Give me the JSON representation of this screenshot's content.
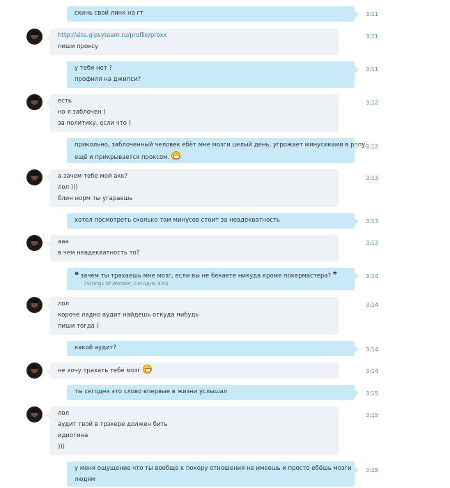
{
  "messages": [
    {
      "dir": "out",
      "time": "3:11",
      "lines": [
        "скинь свой линк на гт"
      ]
    },
    {
      "dir": "in",
      "time": "3:11",
      "lines": [
        "http://site.gipsyteam.ru/profile/proxx",
        "пиши проксу"
      ]
    },
    {
      "dir": "out",
      "time": "3:11",
      "lines": [
        "у тебя нет ?",
        "профиля на джипси?"
      ]
    },
    {
      "dir": "in",
      "time": "3:12",
      "lines": [
        "есть",
        "но я заблочен )",
        "за политику, если что )"
      ]
    },
    {
      "dir": "out",
      "time": "3:12",
      "lines": [
        "прикольно, заблоченный человек ебёт мне мозги целый день, угрожает минусиками в репу,",
        "ещё и прикрывается проксом."
      ]
    },
    {
      "dir": "in",
      "time": "3:13",
      "lines": [
        "а зачем тебе мой акк?",
        "лол )))",
        "блин норм ты угараешь"
      ]
    },
    {
      "dir": "out",
      "time": "3:13",
      "lines": [
        "хотел посмотреть сколько там минусов стоит за неадекватность"
      ]
    },
    {
      "dir": "in",
      "time": "3:13",
      "lines": [
        "ааа",
        "в чем неадекватность то?"
      ]
    },
    {
      "dir": "out",
      "time": "3:14",
      "quote_text": "зачем ты трахаешь мне мозг, если вы не бекаете никуда кроме покермастера?",
      "quote_meta": "7Strings Of Wonder, Сегодня 3:03"
    },
    {
      "dir": "in",
      "time": "3:14",
      "lines": [
        "лол",
        "короче ладно аудит найдешь откуда нибудь",
        "пиши тогда )"
      ]
    },
    {
      "dir": "out",
      "time": "3:14",
      "lines": [
        "какой аудит?"
      ]
    },
    {
      "dir": "in",
      "time": "3:14",
      "lines": [
        "не хочу трахать тебе мозг"
      ]
    },
    {
      "dir": "out",
      "time": "3:15",
      "lines": [
        "ты сегодня это слово впервые в жизни услышал"
      ]
    },
    {
      "dir": "in",
      "time": "3:15",
      "lines": [
        "лол",
        "аудит твой в трэкере должен бить",
        "идиотина",
        ")))"
      ]
    },
    {
      "dir": "out",
      "time": "3:15",
      "lines": [
        "у меня ощущение что ты вообще к покеру отношения не имеешь и просто ебёшь мозги",
        "людям"
      ]
    }
  ]
}
